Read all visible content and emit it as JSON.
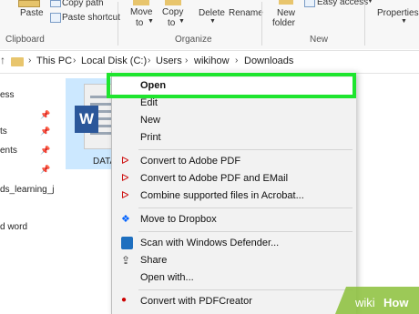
{
  "ribbon": {
    "copy_path": "Copy path",
    "paste": "Paste",
    "paste_shortcut": "Paste shortcut",
    "move_to": "Move",
    "move_to2": "to",
    "copy_to": "Copy",
    "copy_to2": "to",
    "delete": "Delete",
    "rename": "Rename",
    "new_folder": "New",
    "new_folder2": "folder",
    "easy_access": "Easy access",
    "properties": "Properties",
    "groups": {
      "clipboard": "Clipboard",
      "organize": "Organize",
      "new": "New"
    }
  },
  "address": {
    "parts": [
      "This PC",
      "Local Disk (C:)",
      "Users",
      "wikihow",
      "Downloads"
    ]
  },
  "nav": {
    "items": [
      "ess",
      "ts",
      "ents",
      "ds_learning_j",
      "d word"
    ]
  },
  "file": {
    "name": "DATA"
  },
  "context_menu": {
    "items": [
      "Open",
      "Edit",
      "New",
      "Print",
      "Convert to Adobe PDF",
      "Convert to Adobe PDF and EMail",
      "Combine supported files in Acrobat...",
      "Move to Dropbox",
      "Scan with Windows Defender...",
      "Share",
      "Open with...",
      "Convert with PDFCreator"
    ]
  },
  "watermark": {
    "wiki": "wiki",
    "how": "How"
  },
  "colors": {
    "highlight": "#1ee52e",
    "word_blue": "#2b579a",
    "selection": "#cce8ff"
  }
}
